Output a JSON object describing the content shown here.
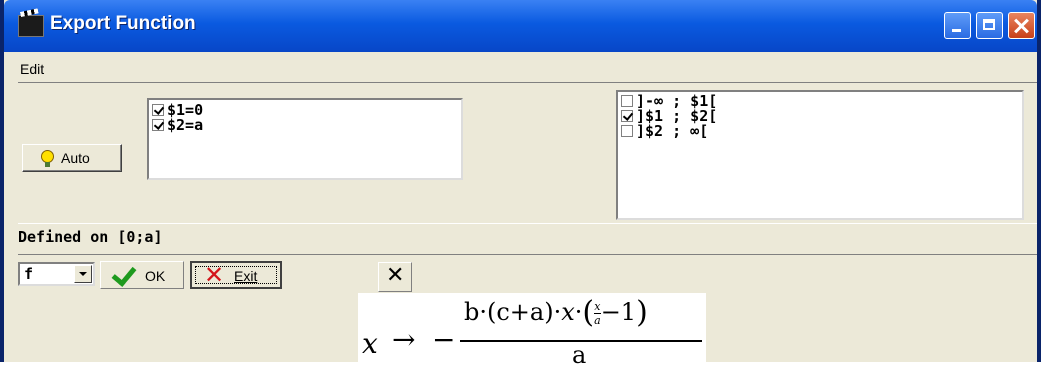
{
  "window": {
    "title": "Export Function"
  },
  "menu": {
    "items": [
      "Edit"
    ]
  },
  "auto_button": {
    "label": "Auto"
  },
  "bounds_list": {
    "items": [
      {
        "label": "$1=0",
        "checked": true
      },
      {
        "label": "$2=a",
        "checked": true
      }
    ]
  },
  "interval_list": {
    "items": [
      {
        "label": "]-∞ ; $1[",
        "checked": false
      },
      {
        "label": "]$1 ; $2[",
        "checked": true
      },
      {
        "label": "]$2 ; ∞[",
        "checked": false
      }
    ]
  },
  "defined_on": "Defined on [0;a]",
  "function_select": {
    "value": "f"
  },
  "ok_button": {
    "label": "OK"
  },
  "exit_button": {
    "label": "Exit"
  },
  "formula": {
    "lhs": "x",
    "arrow": "→",
    "sign": "−",
    "numerator_prefix": "b·(c+a)·",
    "numerator_var": "x",
    "inner_dot": "·",
    "inner_frac_num": "x",
    "inner_frac_den": "a",
    "inner_tail": "−1",
    "denominator": "a"
  },
  "colors": {
    "title_bar": "#0a5ae0",
    "window_bg": "#ece9d8",
    "ok_check": "#1e9a1e",
    "exit_x": "#d4151b"
  }
}
